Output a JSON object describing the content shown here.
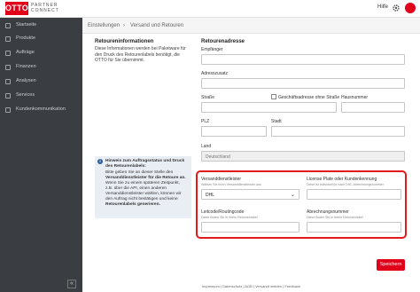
{
  "header": {
    "logo_text": "OTTO",
    "partner_text": "PARTNER\nCONNECT",
    "help_label": "Hilfe",
    "brand_color": "#e1001a"
  },
  "sidebar": {
    "items": [
      {
        "label": "Startseite",
        "icon": "home-icon"
      },
      {
        "label": "Produkte",
        "icon": "box-icon"
      },
      {
        "label": "Aufträge",
        "icon": "orders-icon"
      },
      {
        "label": "Finanzen",
        "icon": "finance-icon"
      },
      {
        "label": "Analysen",
        "icon": "analytics-icon"
      },
      {
        "label": "Services",
        "icon": "services-icon"
      },
      {
        "label": "Kundenkommunikation",
        "icon": "chat-icon"
      }
    ],
    "collapse_glyph": "«"
  },
  "breadcrumb": {
    "root": "Einstellungen",
    "separator": "›",
    "current": "Versand und Retouren"
  },
  "retoureninfo": {
    "title": "Retoureninformationen",
    "description": "Diese Informationen werden bei Paketware für den Druck des Retourenlabels benötigt, die OTTO für Sie übernimmt."
  },
  "retourenadresse": {
    "title": "Retourenadresse",
    "empfaenger_label": "Empfänger",
    "adresszusatz_label": "Adresszusatz",
    "strasse_label": "Straße",
    "no_street_label": "Geschäftsadresse ohne Straße",
    "hausnummer_label": "Hausnummer",
    "plz_label": "PLZ",
    "stadt_label": "Stadt",
    "land_label": "Land",
    "land_value": "Deutschland"
  },
  "info_box": {
    "heading": "Hinweis zum Auftragsstatus und Druck des Retourenlabels:",
    "lines": [
      "Bitte geben Sie an dieser Stelle den",
      "Versanddienstleister für die Retoure an.",
      "Wenn Sie zu einem späteren Zeitpunkt,",
      "z.B. über die API, einen anderen",
      "Versanddienstleister wählen, können wir",
      "den Auftrag nicht bestätigen und keine",
      "Retourenlabels generieren."
    ]
  },
  "versand": {
    "dienstleister_label": "Versanddienstleister",
    "dienstleister_hint": "Wählen Sie Ihren Versanddienstleister aus",
    "dienstleister_value": "DHL",
    "license_label": "License Plate oder Kundenkennung",
    "license_hint": "Diese ist individuell je nach DHL-Abrechnungsnummer",
    "leitcode_label": "Leitcode/Routingcode",
    "leitcode_hint": "Diese finden Sie in Ihrem Retourenlabel",
    "abrechnung_label": "Abrechnungsnummer",
    "abrechnung_hint": "Diese finden Sie in Ihrem Retourenlabel"
  },
  "actions": {
    "save_label": "Speichern"
  },
  "footer": {
    "links": "Impressum | Datenschutz | AGB | Versandt melden | Feedback"
  }
}
